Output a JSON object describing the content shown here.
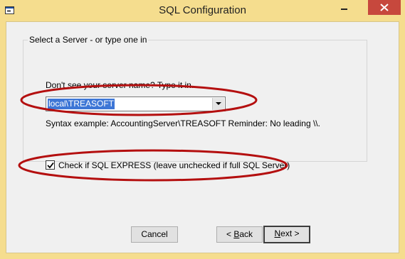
{
  "window": {
    "title": "SQL Configuration",
    "colors": {
      "titlebar": "#f5dd8e",
      "close": "#c7483d",
      "highlight": "#3d76d6",
      "annotation": "#b40f0f"
    }
  },
  "group": {
    "legend": "Select a Server - or type one in"
  },
  "server": {
    "hint": "Don't see your server name?  Type it in.",
    "value": "local\\TREASOFT",
    "syntax": "Syntax example: AccountingServer\\TREASOFT    Reminder: No leading \\\\."
  },
  "express": {
    "label": "Check if SQL EXPRESS (leave unchecked if full SQL Server)",
    "checked": true
  },
  "buttons": {
    "cancel": "Cancel",
    "back_char": "<",
    "back_mnemonic": "B",
    "back_rest": "ack",
    "next_mnemonic": "N",
    "next_rest": "ext >"
  },
  "icons": {
    "app": "window-app-icon",
    "minimize": "minimize-icon",
    "close": "close-icon",
    "dropdown": "chevron-down-icon",
    "check": "checkmark-icon"
  }
}
